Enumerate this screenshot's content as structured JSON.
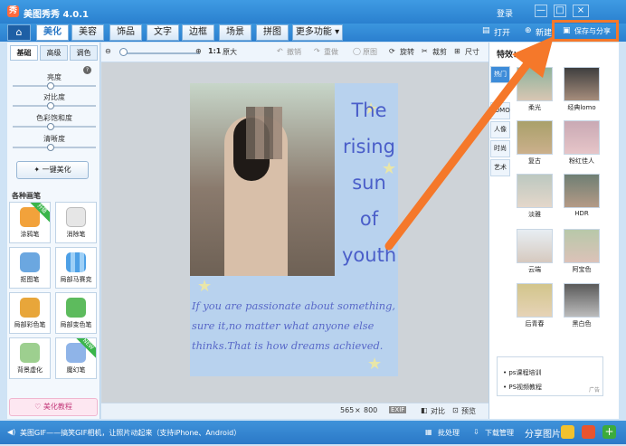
{
  "app": {
    "title": "美图秀秀 4.0.1",
    "logo_char": "秀"
  },
  "titlebar": {
    "login": "登录",
    "min": "—",
    "max": "□",
    "close": "×"
  },
  "nav": {
    "tabs": [
      "美化",
      "美容",
      "饰品",
      "文字",
      "边框",
      "场景",
      "拼图",
      "更多功能 ▾"
    ],
    "active_tab": "美化",
    "open": "打开",
    "new": "新建",
    "save_share": "保存与分享"
  },
  "toolbar": {
    "zoom_ratio": "1:1",
    "original_size": "原大",
    "undo": "撤销",
    "redo": "重做",
    "original": "原图",
    "rotate": "旋转",
    "crop": "裁剪",
    "resize": "尺寸"
  },
  "left": {
    "tabs": [
      "基础",
      "高级",
      "调色"
    ],
    "adjust": [
      "亮度",
      "对比度",
      "色彩饱和度",
      "清晰度"
    ],
    "one_click": "一键美化",
    "brush_title": "各种画笔",
    "brushes": [
      {
        "name": "涂鸦笔",
        "badge": "升级"
      },
      {
        "name": "消除笔",
        "badge": ""
      },
      {
        "name": "抠图笔",
        "badge": ""
      },
      {
        "name": "局部马赛克",
        "badge": ""
      },
      {
        "name": "局部彩色笔",
        "badge": ""
      },
      {
        "name": "局部变色笔",
        "badge": ""
      },
      {
        "name": "背景虚化",
        "badge": ""
      },
      {
        "name": "魔幻笔",
        "badge": "NEW"
      }
    ],
    "tutorial": "美化教程"
  },
  "photo": {
    "title_lines": [
      "The",
      "rising",
      "sun",
      "of",
      "youth"
    ],
    "quote": "If you are passionate about something, sure it,no matter what anyone else thinks.That is how dreams achieved."
  },
  "status": {
    "width": "565",
    "times": "×",
    "height": "800",
    "exif": "EXIF",
    "compare": "对比",
    "preview": "预览"
  },
  "right": {
    "title": "特效：",
    "categories": [
      "热门",
      "LOMO",
      "人像",
      "时尚",
      "艺术"
    ],
    "effects": [
      "柔光",
      "经典lomo",
      "复古",
      "粉红佳人",
      "淡雅",
      "HDR",
      "云端",
      "阿宝色",
      "后青春",
      "黑白色"
    ],
    "ads": [
      "ps课程培训",
      "PS视频教程"
    ],
    "ad_tag": "广告"
  },
  "bottom": {
    "notice": "美图GIF——搞笑GIF相机，让照片动起来（支持iPhone、Android）",
    "batch": "批处理",
    "download": "下载管理",
    "share": "分享图片"
  }
}
